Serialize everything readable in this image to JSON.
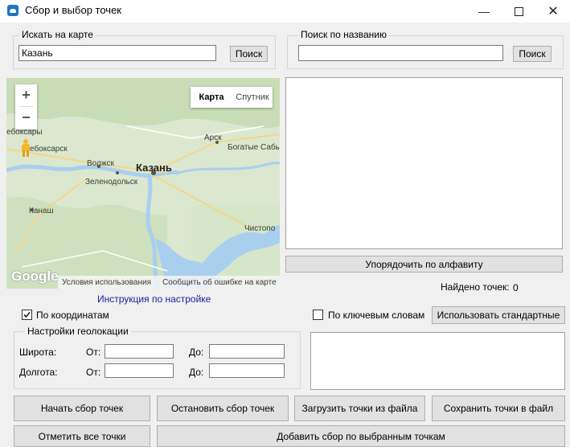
{
  "window": {
    "title": "Сбор и выбор точек",
    "minimize_icon": "minimize-icon",
    "maximize_icon": "maximize-icon",
    "close_icon": "close-icon"
  },
  "map_search": {
    "legend": "Искать на карте",
    "value": "Казань",
    "button": "Поиск"
  },
  "name_search": {
    "legend": "Поиск по названию",
    "value": "",
    "button": "Поиск"
  },
  "map": {
    "tab_map": "Карта",
    "tab_satellite": "Спутник",
    "zoom_in": "+",
    "zoom_out": "−",
    "labels": {
      "kazan": "Казань",
      "cheboksary": "ебоксары",
      "novocheboksarsk": "ебоксарск",
      "volzhsk": "Волжск",
      "zelenodolsk": "Зеленодольск",
      "kanash": "Канаш",
      "arsk": "Арск",
      "bogatye_saby": "Богатые Сабы",
      "chistopol": "Чистопо"
    },
    "google_logo": "Google",
    "terms": "Условия использования",
    "report": "Сообщить об ошибке на карте",
    "pegman_icon": "pegman-icon"
  },
  "instructions_link": "Инструкция по настройке",
  "sort_button": "Упорядочить по алфавиту",
  "found": {
    "label": "Найдено точек:",
    "count": "0"
  },
  "by_coordinates": {
    "label": "По координатам",
    "checked": true
  },
  "by_keywords": {
    "label": "По ключевым словам",
    "checked": false
  },
  "use_standard_button": "Использовать стандартные",
  "geo": {
    "legend": "Настройки геолокации",
    "latitude": "Широта:",
    "longitude": "Долгота:",
    "from": "От:",
    "to": "До:"
  },
  "buttons": {
    "start": "Начать сбор точек",
    "stop": "Остановить сбор точек",
    "load": "Загрузить точки из файла",
    "save": "Сохранить точки в файл",
    "mark_all": "Отметить все точки",
    "add_selected": "Добавить сбор по выбранным точкам"
  }
}
